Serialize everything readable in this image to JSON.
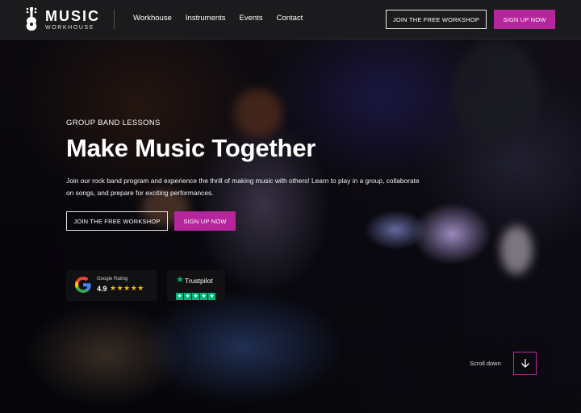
{
  "brand": {
    "name": "MUSIC",
    "tagline": "WORKHOUSE"
  },
  "nav": {
    "links": [
      "Workhouse",
      "Instruments",
      "Events",
      "Contact"
    ]
  },
  "header_buttons": {
    "workshop": "JOIN THE FREE WORKSHOP",
    "signup": "SIGN UP NOW"
  },
  "hero": {
    "eyebrow": "GROUP BAND LESSONS",
    "title": "Make Music Together",
    "description": "Join our rock band program and experience the thrill of making music with others! Learn to play in a group, collaborate on songs, and prepare for exciting performances.",
    "workshop_button": "JOIN THE FREE WORKSHOP",
    "signup_button": "SIGN UP NOW"
  },
  "ratings": {
    "google": {
      "label": "Google Rating",
      "score": "4.9",
      "stars": "★★★★★",
      "icon": "google-g-icon"
    },
    "trustpilot": {
      "label": "Trustpilot",
      "stars": "★★★★★",
      "icon": "trustpilot-star-icon"
    }
  },
  "scroll": {
    "label": "Scroll down",
    "icon": "arrow-down-icon"
  },
  "colors": {
    "accent": "#b5259b",
    "navbar": "#1b1b1d",
    "star": "#f5b81b",
    "trustpilot": "#00b67a"
  }
}
